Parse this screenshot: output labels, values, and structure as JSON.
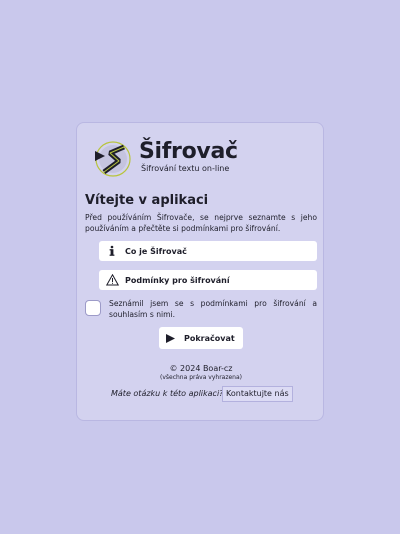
{
  "brand": {
    "title": "Šifrovač",
    "subtitle": "Šifrování textu on-line",
    "logo_icon": "shift-s-logo-icon"
  },
  "welcome": {
    "heading": "Vítejte v aplikaci",
    "intro": "Před používáním Šifrovače, se nejprve seznamte s jeho používáním a přečtěte si podmínkami pro šifrování."
  },
  "links": [
    {
      "label": "Co je Šifrovač",
      "icon": "info-icon"
    },
    {
      "label": "Podmínky pro šifrování",
      "icon": "warning-icon"
    }
  ],
  "consent": {
    "checked": false,
    "label": "Seznámil jsem se s podmínkami pro šifrování a souhlasím s nimi."
  },
  "continue_button": {
    "label": "Pokračovat",
    "icon": "play-icon"
  },
  "footer": {
    "copyright": "© 2024 Boar-cz",
    "rights": "(všechna práva vyhrazena)",
    "question": "Máte otázku k této aplikaci?",
    "contact_label": "Kontaktujte nás"
  },
  "colors": {
    "background": "#c9c8ec",
    "card": "#d3d2ef",
    "text": "#1e1e2a",
    "logo_dark": "#2b2b2b",
    "logo_accent": "#b8c43c"
  }
}
